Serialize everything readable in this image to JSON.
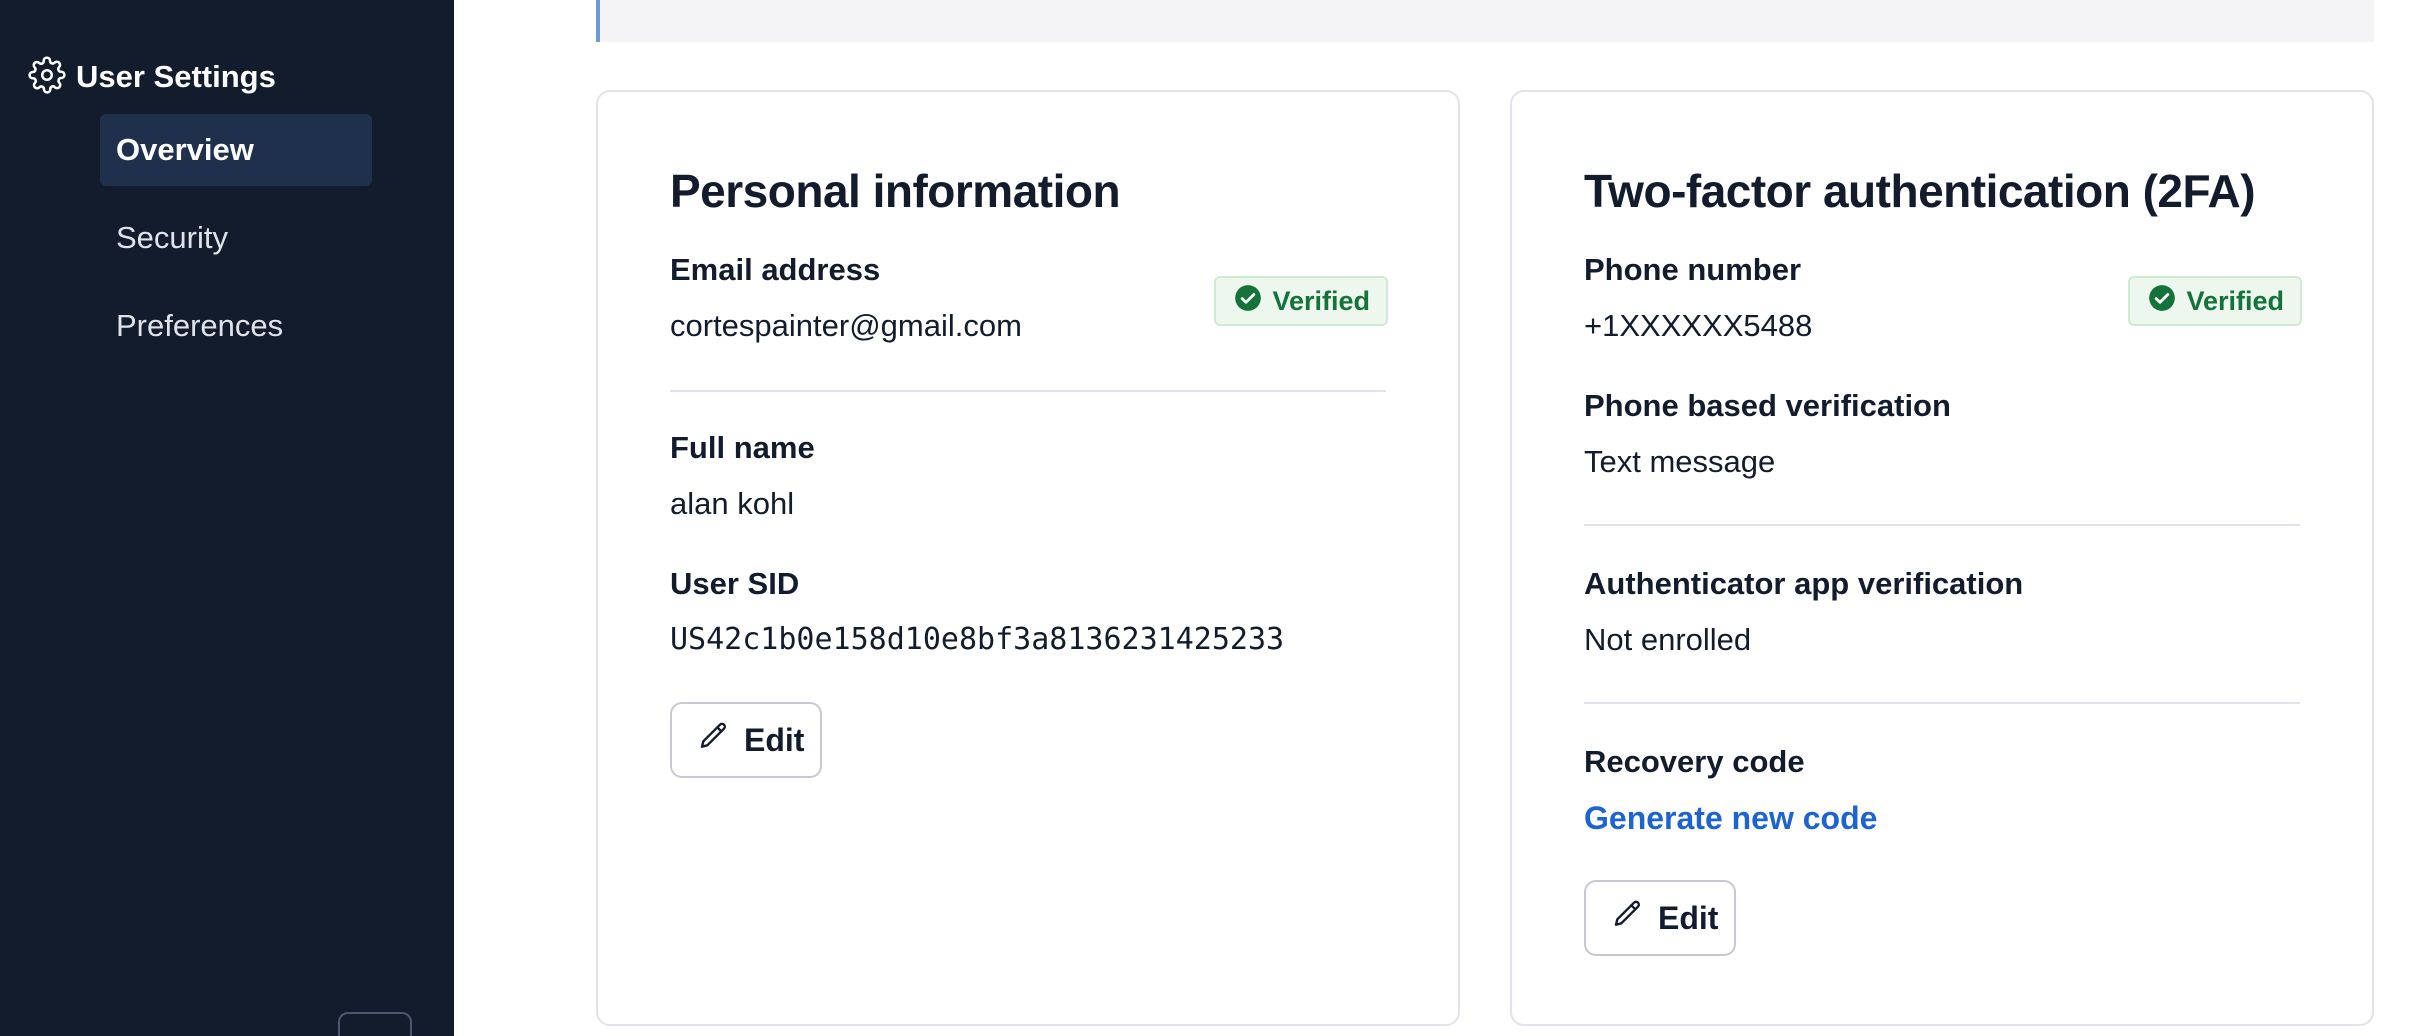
{
  "sidebar": {
    "title": "User Settings",
    "items": [
      {
        "label": "Overview",
        "active": true
      },
      {
        "label": "Security",
        "active": false
      },
      {
        "label": "Preferences",
        "active": false
      }
    ]
  },
  "personal": {
    "title": "Personal information",
    "email_label": "Email address",
    "email_value": "cortespainter@gmail.com",
    "email_badge": "Verified",
    "name_label": "Full name",
    "name_value": "alan kohl",
    "sid_label": "User SID",
    "sid_value": "US42c1b0e158d10e8bf3a8136231425233",
    "edit_label": "Edit"
  },
  "twofa": {
    "title": "Two-factor authentication (2FA)",
    "phone_label": "Phone number",
    "phone_value": "+1XXXXXX5488",
    "phone_badge": "Verified",
    "method_label": "Phone based verification",
    "method_value": "Text message",
    "app_label": "Authenticator app verification",
    "app_value": "Not enrolled",
    "recovery_label": "Recovery code",
    "recovery_link": "Generate new code",
    "edit_label": "Edit"
  },
  "icons": {
    "settings": "gear-icon",
    "verified": "check-circle-icon",
    "edit": "pencil-icon"
  },
  "colors": {
    "sidebar_bg": "#121c2d",
    "active_item_bg": "#1f304c",
    "verified_text": "#14733b",
    "verified_bg": "#edf7ee",
    "link": "#1d63d2"
  }
}
